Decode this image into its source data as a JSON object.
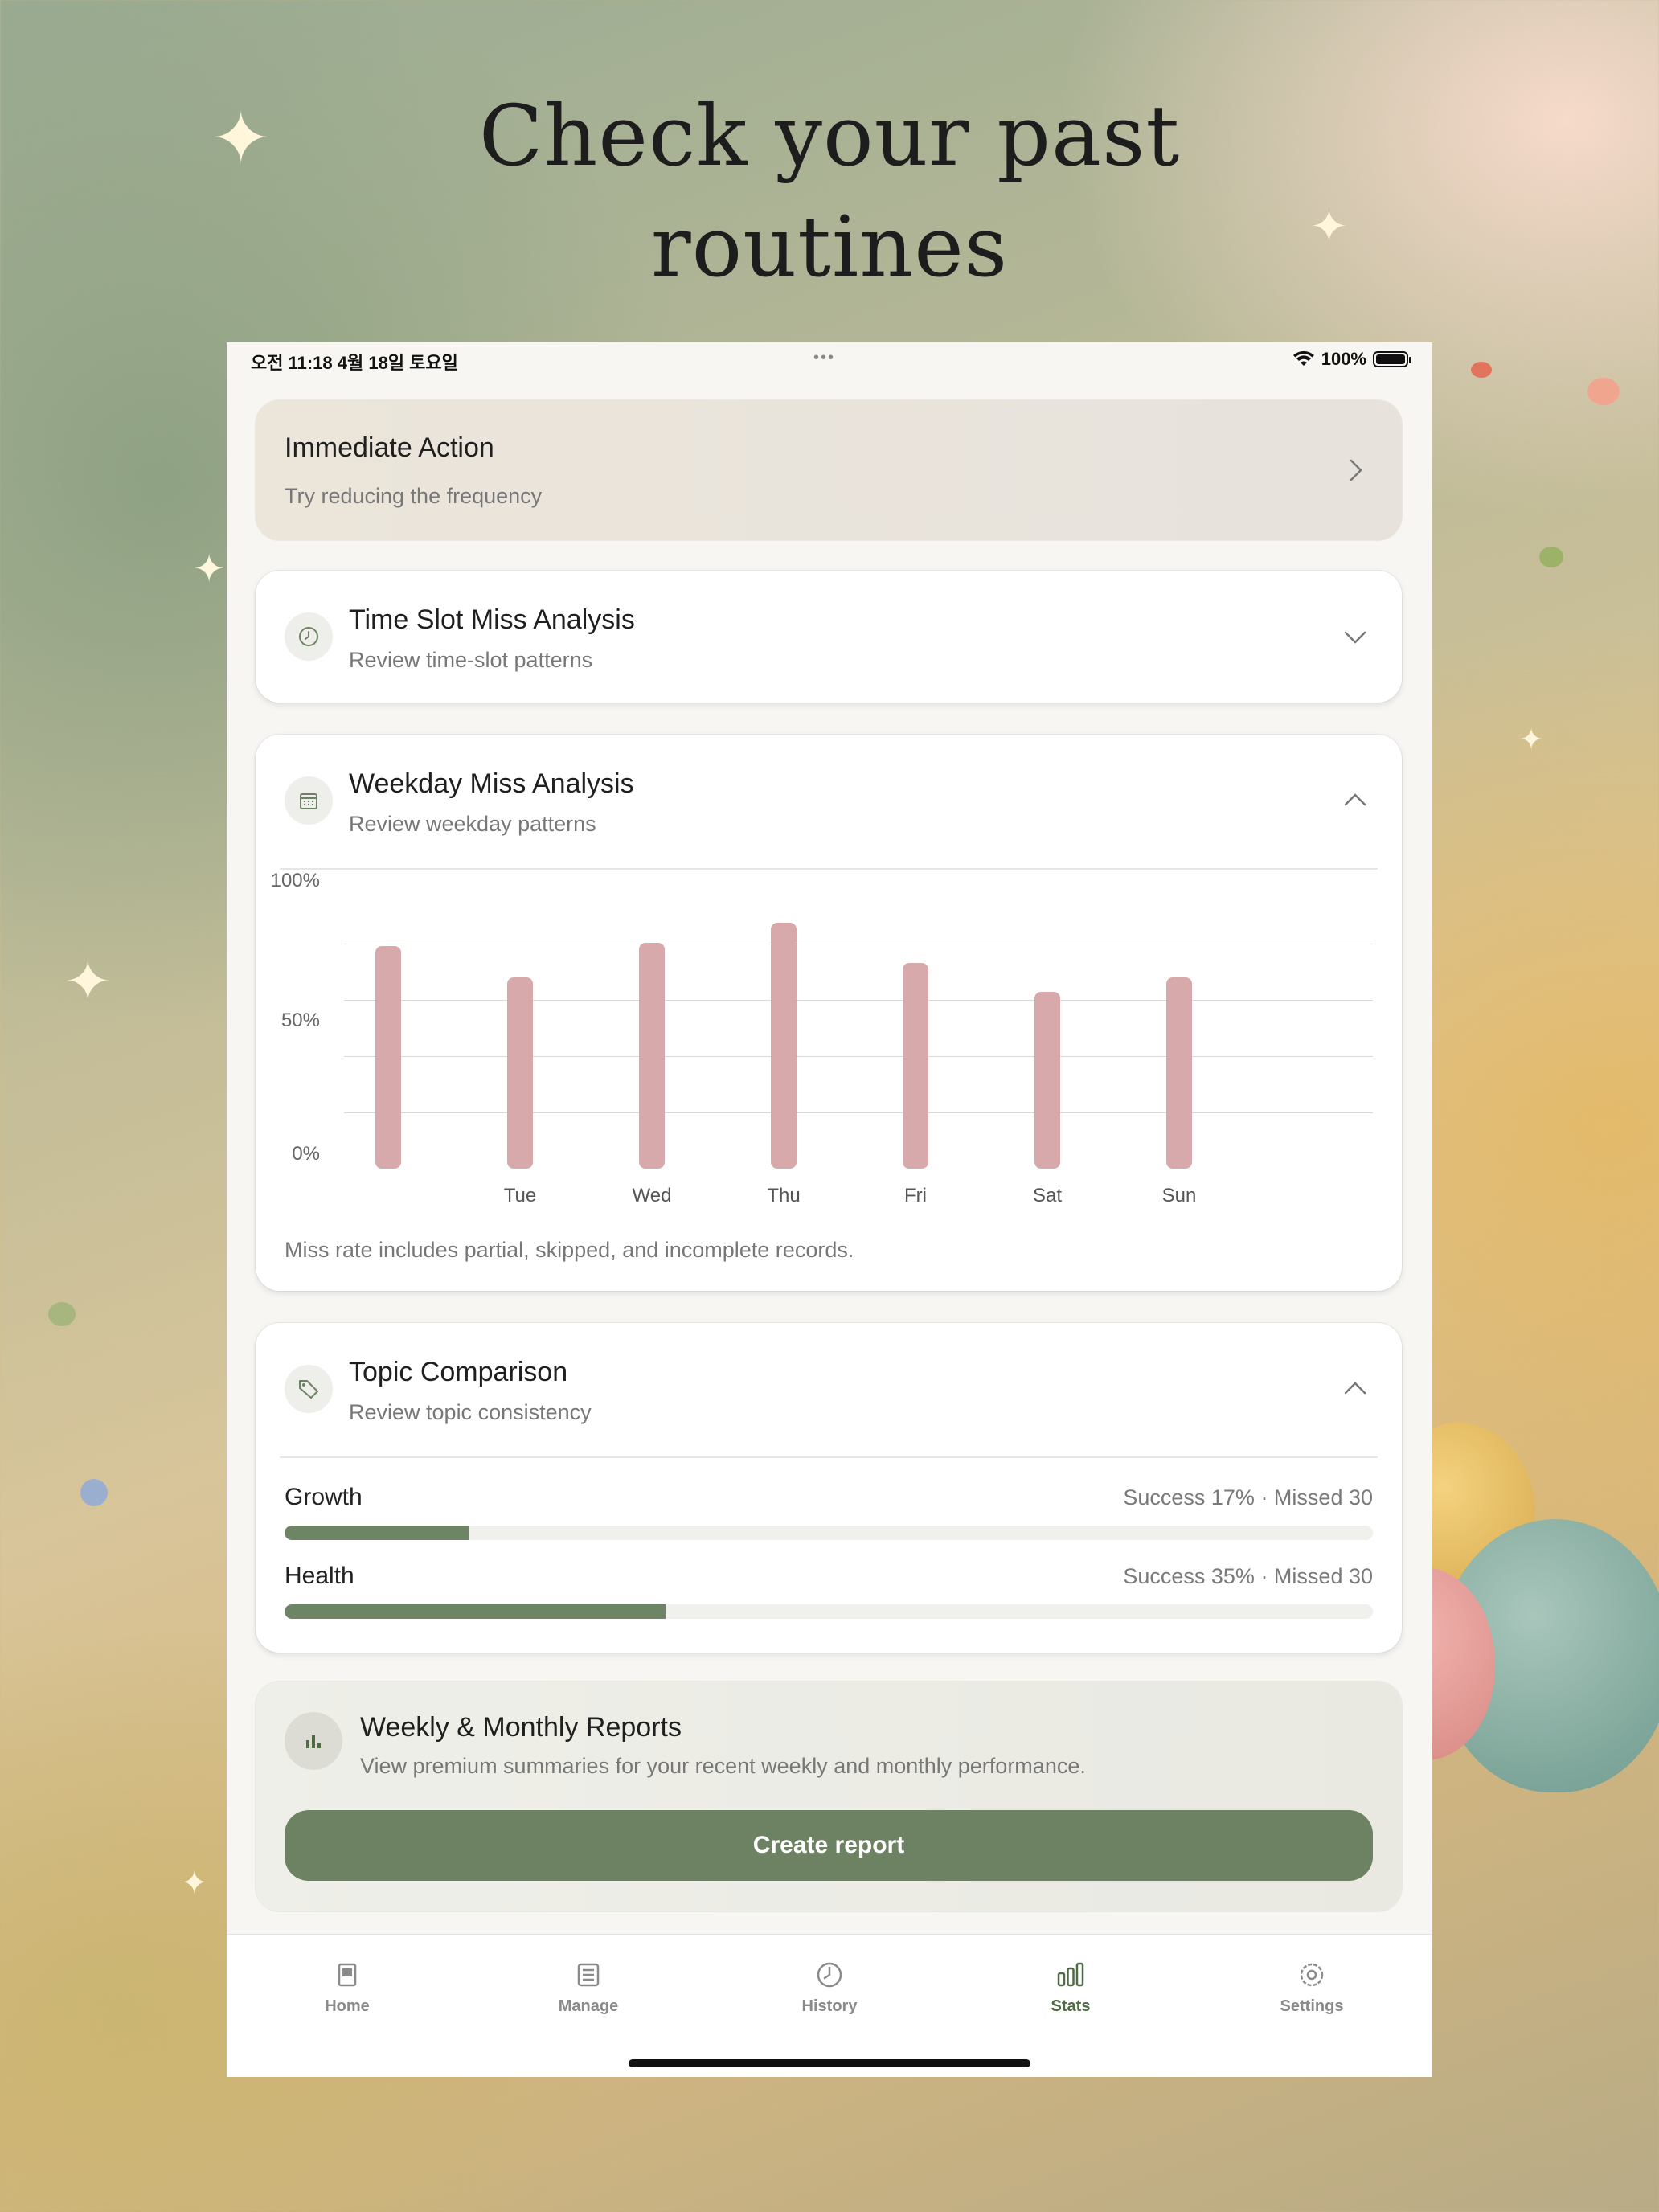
{
  "headline": {
    "line1": "Check your past",
    "line2": "routines"
  },
  "status_bar": {
    "time_date": "오전 11:18   4월 18일 토요일",
    "dots": "•••",
    "battery": "100%"
  },
  "immediate_action": {
    "title": "Immediate Action",
    "subtitle": "Try reducing the frequency"
  },
  "time_slot": {
    "title": "Time Slot Miss Analysis",
    "subtitle": "Review time-slot patterns"
  },
  "weekday": {
    "title": "Weekday Miss Analysis",
    "subtitle": "Review weekday patterns",
    "note": "Miss rate includes partial, skipped, and incomplete records."
  },
  "chart_data": {
    "type": "bar",
    "categories": [
      "",
      "Tue",
      "Wed",
      "Thu",
      "Fri",
      "Sat",
      "Sun"
    ],
    "values": [
      77,
      66,
      78,
      85,
      71,
      61,
      66
    ],
    "ylim": [
      0,
      100
    ],
    "yticks": [
      "100%",
      "50%",
      "0%"
    ],
    "bar_color": "#d8a9ab",
    "grid": true
  },
  "topic": {
    "title": "Topic Comparison",
    "subtitle": "Review topic consistency",
    "items": [
      {
        "name": "Growth",
        "stat": "Success 17% · Missed 30",
        "success": 0.17
      },
      {
        "name": "Health",
        "stat": "Success 35% · Missed 30",
        "success": 0.35
      }
    ]
  },
  "reports": {
    "title": "Weekly & Monthly Reports",
    "subtitle": "View premium summaries for your recent weekly and monthly performance.",
    "button": "Create report"
  },
  "tabs": [
    {
      "label": "Home",
      "icon": "home-icon"
    },
    {
      "label": "Manage",
      "icon": "list-icon"
    },
    {
      "label": "History",
      "icon": "clock-icon"
    },
    {
      "label": "Stats",
      "icon": "bar-chart-icon",
      "active": true
    },
    {
      "label": "Settings",
      "icon": "gear-icon"
    }
  ],
  "colors": {
    "accent": "#6d8263",
    "bar": "#d8a9ab",
    "card_bg": "#ffffff"
  }
}
